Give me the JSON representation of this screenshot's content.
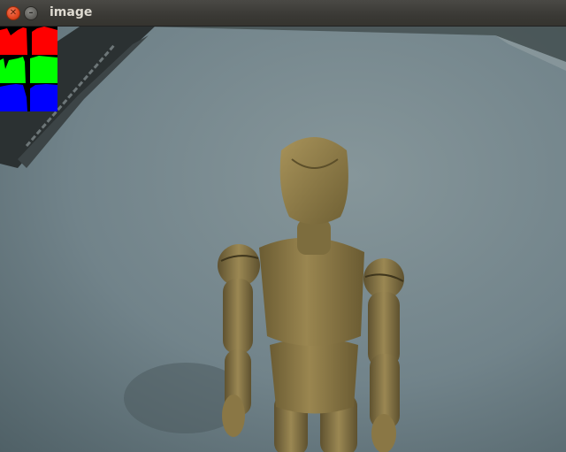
{
  "window": {
    "title": "image",
    "close_icon": "close-icon",
    "minimize_icon": "minimize-icon"
  },
  "histogram": {
    "channels": [
      "red",
      "green",
      "blue"
    ],
    "colors": {
      "red": "#ff0000",
      "green": "#00ff00",
      "blue": "#0000ff"
    }
  },
  "colors": {
    "titlebar": "#3c3b37",
    "surface": "#6f8185",
    "figure_wood": "#8c7a48"
  }
}
